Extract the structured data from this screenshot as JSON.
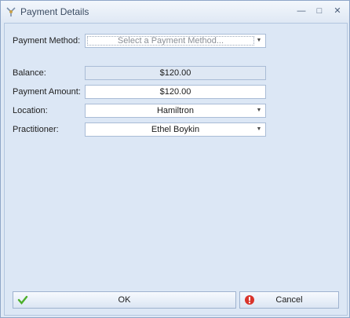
{
  "window": {
    "title": "Payment Details"
  },
  "controls": {
    "minimize": "—",
    "maximize": "□",
    "close": "✕"
  },
  "form": {
    "payment_method": {
      "label": "Payment Method:",
      "placeholder": "Select a Payment Method..."
    },
    "balance": {
      "label": "Balance:",
      "value": "$120.00"
    },
    "payment_amount": {
      "label": "Payment Amount:",
      "value": "$120.00"
    },
    "location": {
      "label": "Location:",
      "value": "Hamiltron"
    },
    "practitioner": {
      "label": "Practitioner:",
      "value": "Ethel Boykin"
    }
  },
  "buttons": {
    "ok": "OK",
    "cancel": "Cancel"
  },
  "colors": {
    "ok_icon": "#4caf2a",
    "cancel_icon": "#d9342b"
  }
}
